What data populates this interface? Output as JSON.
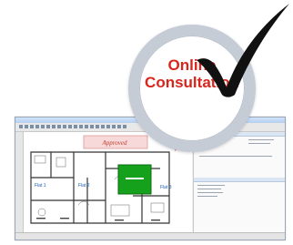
{
  "badge": {
    "line1": "Online",
    "line2": "Consultation",
    "text_color": "#d9261c",
    "ring_color": "#c5ccd6"
  },
  "icons": {
    "check": "checkmark-icon"
  },
  "screenshot": {
    "stamp_text": "Approved",
    "room_labels": [
      "Flat 1",
      "Flat 2",
      "Flat 3"
    ],
    "highlight_color": "#16a11c"
  }
}
